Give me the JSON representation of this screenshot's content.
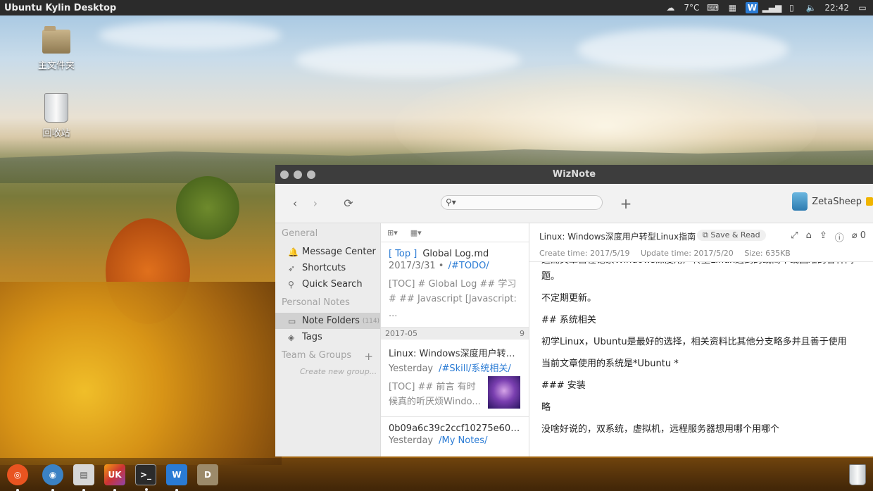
{
  "panel": {
    "title": "Ubuntu Kylin Desktop",
    "weather": "7°C",
    "clock": "22:42",
    "tray_icons": [
      "weather-icon",
      "keyboard-icon",
      "calendar-icon",
      "wiznote-tray-icon",
      "signal-icon",
      "battery-icon",
      "volume-icon",
      "display-icon"
    ],
    "wiz_glyph": "W"
  },
  "desktop": {
    "home_label": "主文件夹",
    "trash_label": "回收站"
  },
  "window": {
    "title": "WizNote",
    "user": "ZetaSheep",
    "search_placeholder": ""
  },
  "sidebar": {
    "general_header": "General",
    "items": [
      {
        "label": "Message Center",
        "icon": "bell-icon"
      },
      {
        "label": "Shortcuts",
        "icon": "rocket-icon"
      },
      {
        "label": "Quick Search",
        "icon": "search-icon"
      }
    ],
    "personal_header": "Personal Notes",
    "note_folders": "Note Folders",
    "note_folders_count": "(114)",
    "tags": "Tags",
    "team_header": "Team & Groups",
    "create_group": "Create new group..."
  },
  "notes": {
    "top_tag": "[ Top ]",
    "items": [
      {
        "title": "Global Log.md",
        "date": "2017/3/31",
        "folder": "/#TODO/",
        "abstract": "[TOC] # Global Log ## 学习 # ## Javascript [Javascript: ..."
      },
      {
        "title": "Linux: Windows深度用户转型...",
        "date": "Yesterday",
        "folder": "/#Skill/系统相关/",
        "abstract": "[TOC] ## 前言 有时候真的听厌烦Windo..."
      },
      {
        "title": "0b09a6c39c2ccf10275e60fa...",
        "date": "Yesterday",
        "folder": "/My Notes/",
        "abstract": ""
      }
    ],
    "group_label": "2017-05",
    "group_count": "9"
  },
  "doc": {
    "title": "Linux: Windows深度用户转型Linux指南",
    "save_read": "Save & Read",
    "attach_count": "0",
    "create_time": "Create time: 2017/5/19",
    "update_time": "Update time: 2017/5/20",
    "size": "Size: 635KB",
    "paragraphs": [
      "这篇文章旨在记录Windows深度用户转型Linux遇到的或简单或困难的各种问题。",
      "不定期更新。",
      "## 系统相关",
      "初学Linux，Ubuntu是最好的选择，相关资料比其他分支略多并且善于使用",
      "当前文章使用的系统是*Ubuntu *",
      "### 安装",
      "略",
      "没啥好说的，双系统，虚拟机，远程服务器想用哪个用哪个"
    ]
  },
  "dock": {
    "apps": [
      {
        "name": "dash-icon",
        "glyph": "◎",
        "color": "#e95420"
      },
      {
        "name": "chromium-icon",
        "glyph": "◉",
        "color": "#3b82c4"
      },
      {
        "name": "files-icon",
        "glyph": "▤",
        "color": "#d7d7d7"
      },
      {
        "name": "kylin-software-icon",
        "glyph": "UK",
        "color": "#c33"
      },
      {
        "name": "terminal-icon",
        "glyph": ">_",
        "color": "#2b2b2b"
      },
      {
        "name": "wiznote-icon",
        "glyph": "W",
        "color": "#2a7bd4"
      },
      {
        "name": "file-manager-icon",
        "glyph": "D",
        "color": "#9c8a6a"
      }
    ]
  },
  "colors": {
    "accent": "#2a7bd4",
    "panel": "#2b2b2b",
    "titlebar": "#3d3d3d"
  }
}
